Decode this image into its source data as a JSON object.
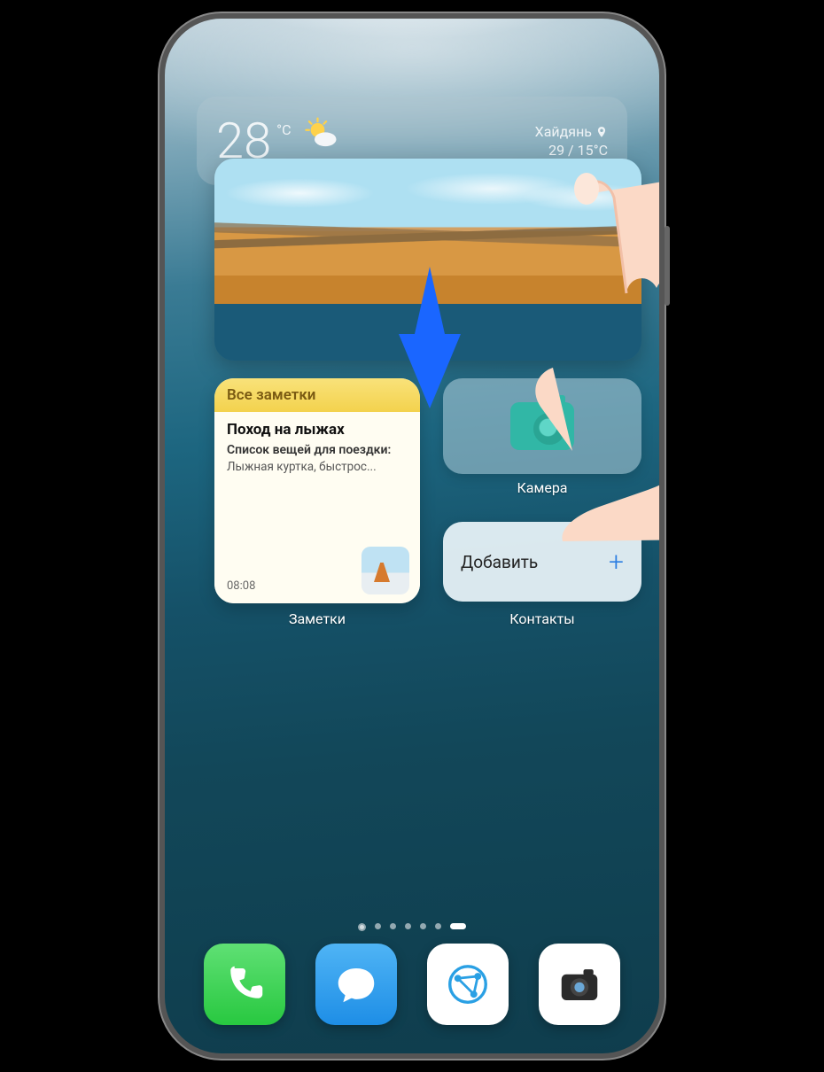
{
  "weather": {
    "temp": "28",
    "unit": "°C",
    "location": "Хайдянь",
    "hi_lo": "29 / 15°C"
  },
  "notes": {
    "header": "Все заметки",
    "title": "Поход на лыжах",
    "subtitle": "Список вещей для поездки:",
    "snippet": "Лыжная куртка, быстрос...",
    "time": "08:08",
    "label": "Заметки"
  },
  "camera": {
    "label": "Камера"
  },
  "contacts": {
    "button": "Добавить",
    "label": "Контакты"
  },
  "pager": {
    "count": 7,
    "active_index": 6
  },
  "dock": {
    "apps": [
      "phone",
      "messages",
      "browser",
      "camera"
    ]
  }
}
